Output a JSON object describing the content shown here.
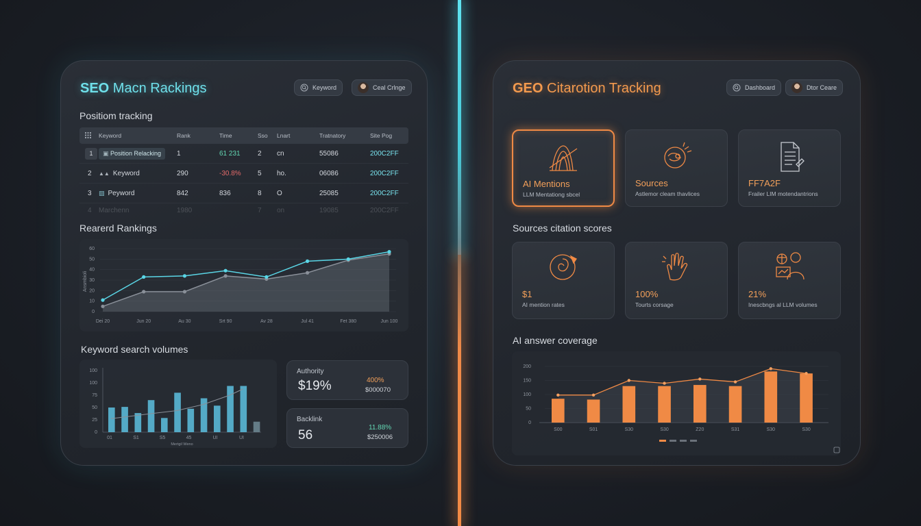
{
  "seo": {
    "title_bold": "SEO",
    "title_rest": " Macn Rackings",
    "search_pill": "Keyword",
    "user_pill": "Ceal Crlnge",
    "position_tracking_label": "Positiom tracking",
    "table": {
      "headers": [
        "Keyword",
        "Rank",
        "Time",
        "Sso",
        "Lnart",
        "Tratnatory",
        "Site Pog"
      ],
      "rows": [
        {
          "num": "1",
          "keyword": "Position Relacking",
          "rank": "1",
          "time": "61 231",
          "sso": "2",
          "lnart": "cn",
          "tratnatory": "55086",
          "site": "200C2FF"
        },
        {
          "num": "2",
          "keyword": "Keyword",
          "rank": "290",
          "time": "-30.8%",
          "sso": "5",
          "lnart": "ho.",
          "tratnatory": "06086",
          "site": "200C2FF"
        },
        {
          "num": "3",
          "keyword": "Peyword",
          "rank": "842",
          "time": "836",
          "sso": "8",
          "lnart": "O",
          "tratnatory": "25085",
          "site": "200C2FF"
        },
        {
          "num": "4",
          "keyword": "Marchenn",
          "rank": "1980",
          "time": "",
          "sso": "7",
          "lnart": "on",
          "tratnatory": "19085",
          "site": "200C2FF"
        }
      ]
    },
    "rankings_label": "Rearerd Rankings",
    "keyword_volumes_label": "Keyword search volumes",
    "authority": {
      "label": "Authority",
      "value": "$19%",
      "pct": "400%",
      "amount": "$000070"
    },
    "backlink": {
      "label": "Backlink",
      "value": "56",
      "pct": "11.88%",
      "amount": "$250006"
    }
  },
  "geo": {
    "title_bold": "GEO",
    "title_rest": " Citarotion Tracking",
    "dashboard_pill": "Dashboard",
    "user_pill": "Dtor Ceare",
    "cards": [
      {
        "title": "AI Mentions",
        "sub": "LLM Mentationg sbcel"
      },
      {
        "title": "Sources",
        "sub": "Astlemor cleam thavlices"
      },
      {
        "title": "FF7A2F",
        "sub": "Frailer LIM motendantrions"
      }
    ],
    "citation_label": "Sources citation scores",
    "score_cards": [
      {
        "value": "$1",
        "sub": "AI mention rates"
      },
      {
        "value": "100%",
        "sub": "Tourts corsage"
      },
      {
        "value": "21%",
        "sub": "Inescbngs al LLM volumes"
      }
    ],
    "coverage_label": "AI answer coverage"
  },
  "chart_data": [
    {
      "type": "line",
      "title": "Rearerd Rankings",
      "ylabel": "Ansmbioli",
      "x": [
        "Dei 20",
        "Jun 20",
        "Au 30",
        "Srt 90",
        "Av 28",
        "Jul 41",
        "Fet 380",
        "Jun 100"
      ],
      "ylim": [
        0,
        60
      ],
      "yticks": [
        0,
        10,
        20,
        30,
        40,
        50,
        60
      ],
      "series": [
        {
          "values": [
            11,
            33,
            34,
            39,
            33,
            48,
            50,
            57
          ],
          "color": "#5ad6e6"
        },
        {
          "values": [
            5,
            19,
            19,
            34,
            31,
            37,
            49,
            55
          ],
          "color": "#8a9099"
        }
      ]
    },
    {
      "type": "bar",
      "title": "Keyword search volumes",
      "categories": [
        "01",
        "",
        "S1",
        "",
        "S5",
        "",
        "45",
        "",
        "UI",
        "",
        "UI",
        ""
      ],
      "xlabel": "Mertgil Weno",
      "ylim": [
        0,
        100
      ],
      "yticks": [
        0,
        25,
        50,
        75,
        100,
        100
      ],
      "values": [
        40,
        41,
        31,
        52,
        23,
        64,
        38,
        55,
        43,
        75,
        75,
        17
      ]
    },
    {
      "type": "bar",
      "title": "AI answer coverage",
      "categories": [
        "S00",
        "S01",
        "S30",
        "S30",
        "Z20",
        "S31",
        "S30",
        "S30"
      ],
      "ylim": [
        0,
        200
      ],
      "yticks": [
        0,
        50,
        100,
        150,
        200
      ],
      "values": [
        85,
        82,
        130,
        130,
        134,
        130,
        182,
        175
      ],
      "line": [
        98,
        98,
        150,
        140,
        155,
        145,
        192,
        175
      ]
    }
  ]
}
